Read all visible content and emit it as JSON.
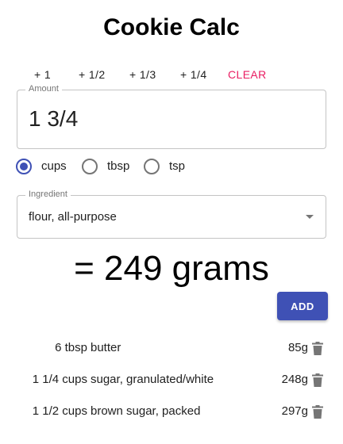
{
  "app": {
    "title": "Cookie Calc"
  },
  "fractions": [
    {
      "label": "+ 1"
    },
    {
      "label": "+ 1/2"
    },
    {
      "label": "+ 1/3"
    },
    {
      "label": "+ 1/4"
    },
    {
      "label": "CLEAR"
    }
  ],
  "amount": {
    "label": "Amount",
    "value": "1 3/4"
  },
  "units": {
    "selected": "cups",
    "options": [
      {
        "label": "cups",
        "checked": true
      },
      {
        "label": "tbsp",
        "checked": false
      },
      {
        "label": "tsp",
        "checked": false
      }
    ]
  },
  "ingredient": {
    "label": "Ingredient",
    "value": "flour, all-purpose"
  },
  "result": {
    "text": "= 249 grams"
  },
  "add_button": {
    "label": "ADD"
  },
  "items": [
    {
      "qty": "6 tbsp",
      "name": "butter",
      "grams": "85g"
    },
    {
      "qty": "1 1/4 cups",
      "name": "sugar, granulated/white",
      "grams": "248g"
    },
    {
      "qty": "1 1/2 cups",
      "name": "brown sugar, packed",
      "grams": "297g"
    }
  ],
  "colors": {
    "accent": "#3f51b5",
    "clear": "#e91e63"
  }
}
